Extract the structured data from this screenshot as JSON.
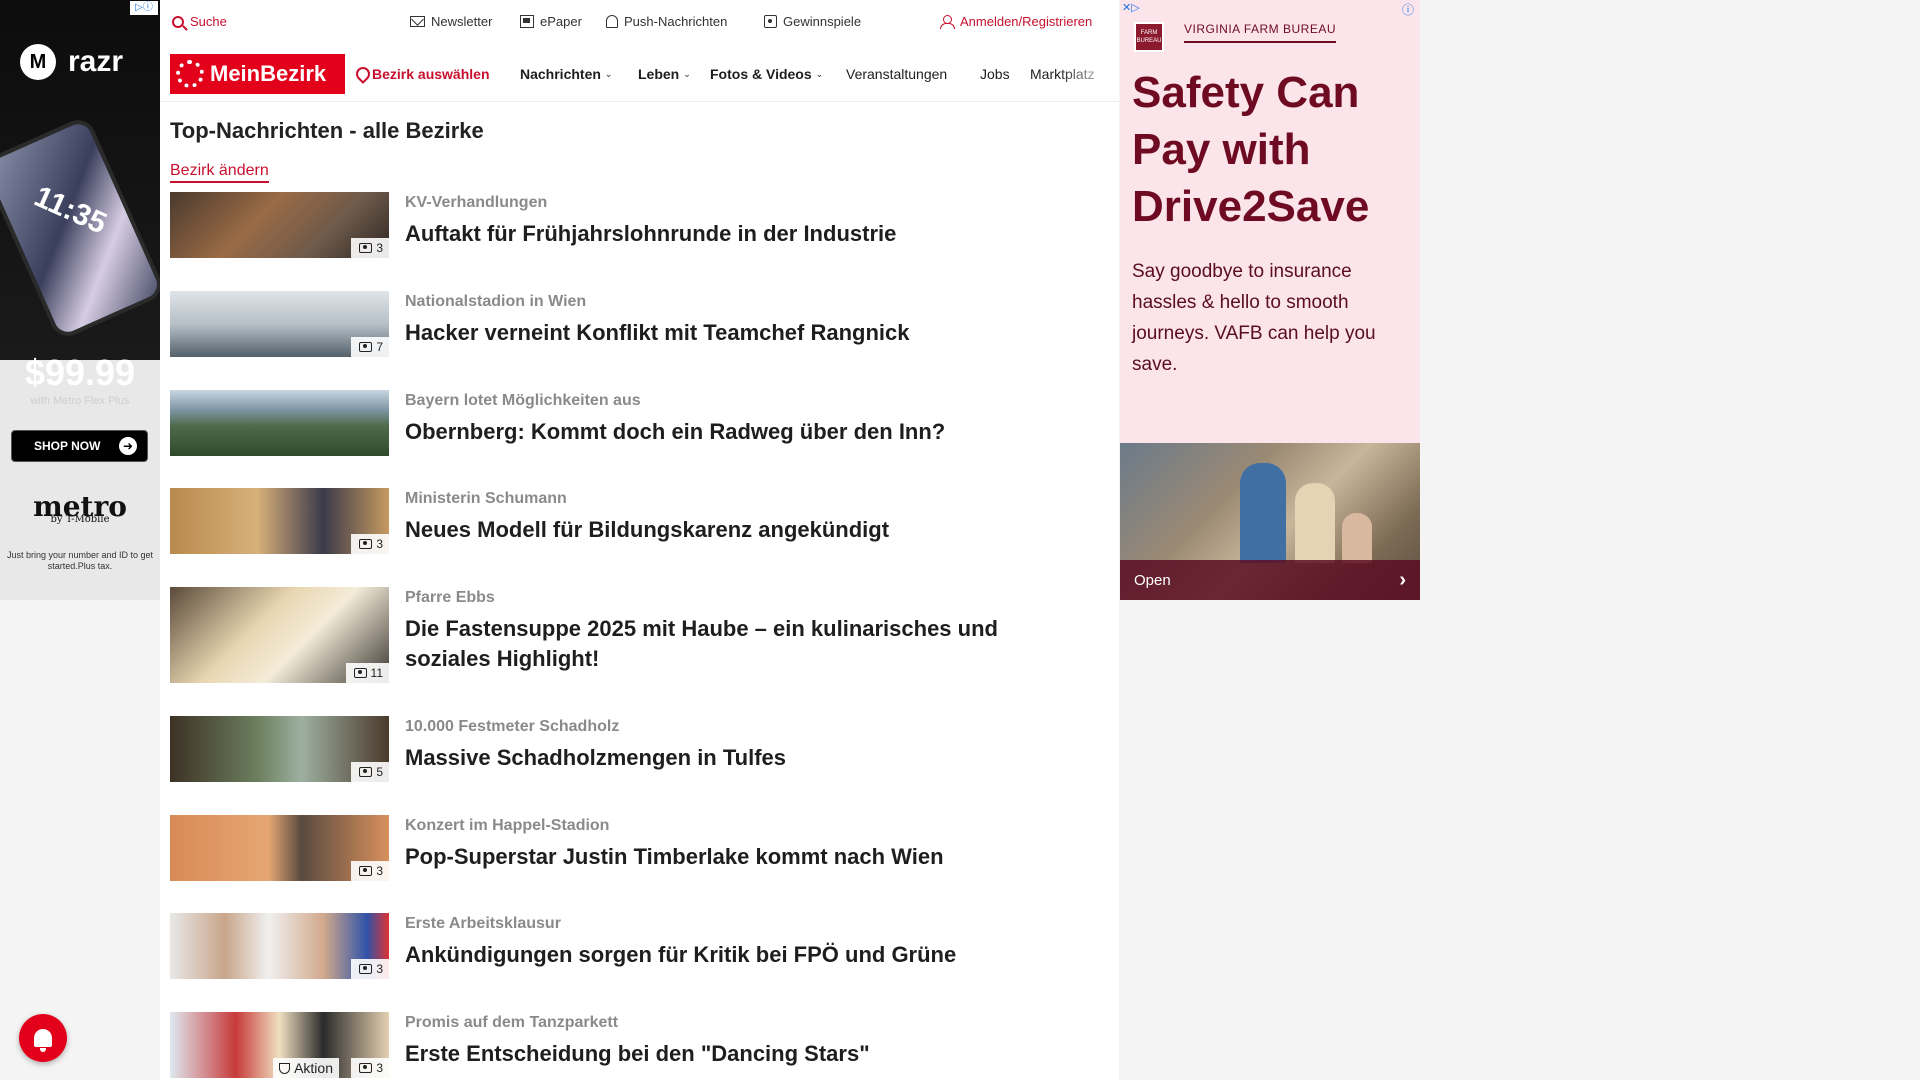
{
  "ad_left": {
    "brand": "razr",
    "motorola_icon": "motorola-logo-icon",
    "phone_time": "11:35",
    "price": "$99.99",
    "plan": "with Metro Flex Plus",
    "cta": "SHOP NOW",
    "metro": "metro",
    "metro_sub": "by T-Mobile",
    "disclaimer": "Just bring your number and ID to get started.Plus tax."
  },
  "topbar": {
    "search": "Suche",
    "newsletter": "Newsletter",
    "epaper": "ePaper",
    "push": "Push-Nachrichten",
    "contests": "Gewinnspiele",
    "login": "Anmelden/Registrieren"
  },
  "nav": {
    "logo": "MeinBezirk",
    "district": "Bezirk auswählen",
    "items": [
      "Nachrichten",
      "Leben",
      "Fotos & Videos",
      "Veranstaltungen",
      "Jobs",
      "Marktplatz"
    ]
  },
  "section": {
    "title": "Top-Nachrichten - alle Bezirke",
    "change": "Bezirk ändern"
  },
  "articles": [
    {
      "kicker": "KV-Verhandlungen",
      "headline": "Auftakt für Frühjahrslohnrunde in der Industrie",
      "count": "3"
    },
    {
      "kicker": "Nationalstadion in Wien",
      "headline": "Hacker verneint Konflikt mit Teamchef Rangnick",
      "count": "7"
    },
    {
      "kicker": "Bayern lotet Möglichkeiten aus",
      "headline": "Obernberg: Kommt doch ein Radweg über den Inn?",
      "count": ""
    },
    {
      "kicker": "Ministerin Schumann",
      "headline": "Neues Modell für Bildungskarenz angekündigt",
      "count": "3"
    },
    {
      "kicker": "Pfarre Ebbs",
      "headline": "Die Fastensuppe 2025 mit Haube – ein kulinarisches und soziales Highlight!",
      "count": "11"
    },
    {
      "kicker": "10.000 Festmeter Schadholz",
      "headline": "Massive Schadholzmengen in Tulfes",
      "count": "5"
    },
    {
      "kicker": "Konzert im Happel-Stadion",
      "headline": "Pop-Superstar Justin Timberlake kommt nach Wien",
      "count": "3"
    },
    {
      "kicker": "Erste Arbeitsklausur",
      "headline": "Ankündigungen sorgen für Kritik bei FPÖ und Grüne",
      "count": "3"
    },
    {
      "kicker": "Promis auf dem Tanzparkett",
      "headline": "Erste Entscheidung bei den \"Dancing Stars\"",
      "count": "3",
      "tag": "Aktion"
    }
  ],
  "ad_right": {
    "advertiser": "VIRGINIA FARM BUREAU",
    "logo_text": "FARM BUREAU",
    "headline": "Safety Can Pay with Drive2Save",
    "body": "Say goodbye to insurance hassles & hello to smooth journeys. VAFB can help you save.",
    "cta": "Open"
  },
  "colors": {
    "brand_red": "#e2001a",
    "link_red": "#c8102e",
    "ad_pink": "#fbe4ea",
    "ad_maroon": "#6e0b23"
  }
}
